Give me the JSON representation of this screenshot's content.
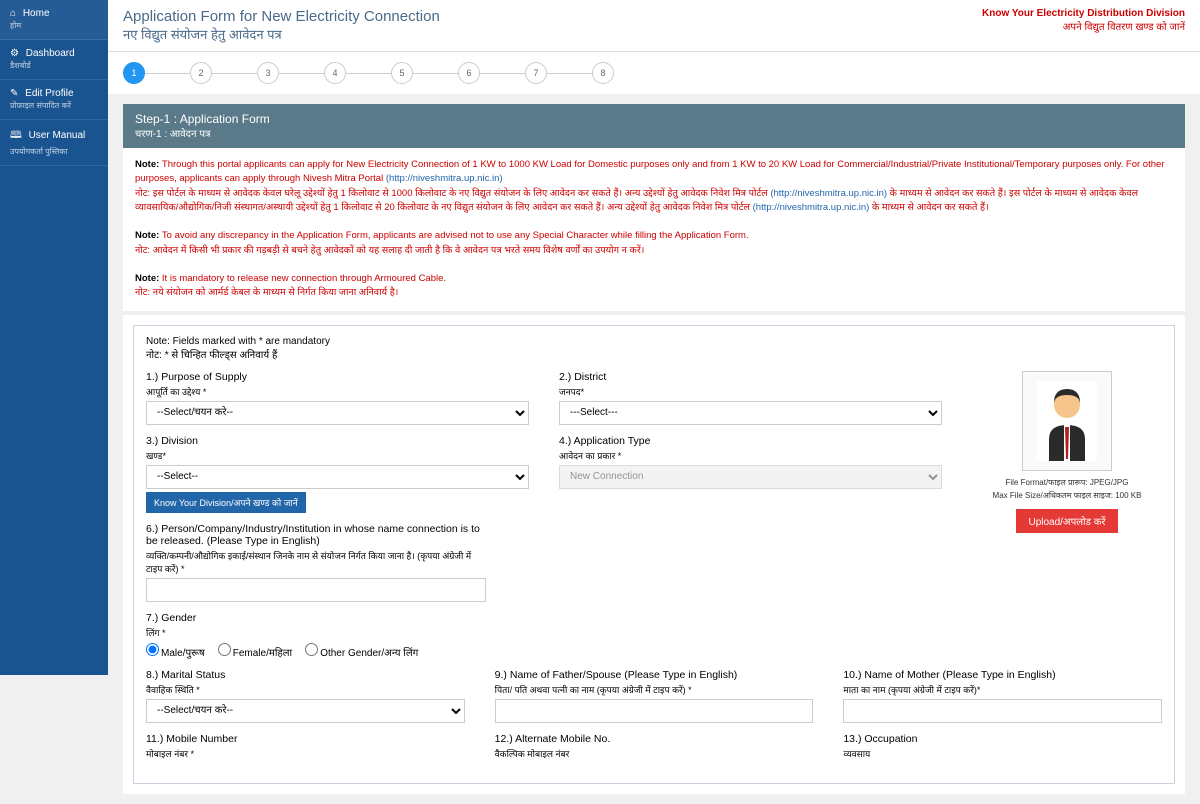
{
  "sidebar": {
    "items": [
      {
        "icon": "⌂",
        "label": "Home",
        "sub": "होम"
      },
      {
        "icon": "⚙",
        "label": "Dashboard",
        "sub": "डैशबोर्ड"
      },
      {
        "icon": "✎",
        "label": "Edit Profile",
        "sub": "प्रोफ़ाइल संपादित करें"
      },
      {
        "icon": "🕮",
        "label": "User Manual",
        "sub": "उपयोगकर्ता पुस्तिका"
      }
    ]
  },
  "header": {
    "title_en": "Application Form for New Electricity Connection",
    "title_hi": "नए विद्युत संयोजन हेतु आवेदन पत्र",
    "right1": "Know Your Electricity Distribution Division",
    "right2": "अपने विद्युत वितरण खण्ड को जानें"
  },
  "stepper": {
    "current": 1,
    "total": 8
  },
  "section": {
    "title": "Step-1 : Application Form",
    "subtitle": "चरण-1 : आवेदन पत्र"
  },
  "notes": {
    "n1_label": "Note: ",
    "n1_red": "Through this portal applicants can apply for New Electricity Connection of 1 KW to 1000 KW Load for Domestic purposes only and from 1 KW to 20 KW Load for Commercial/Industrial/Private Institutional/Temporary purposes only. For other purposes, applicants can apply through Nivesh Mitra Portal ",
    "n1_link": "(http://niveshmitra.up.nic.in)",
    "n2_red1": "नोट: इस पोर्टल के माध्यम से आवेदक केवल घरेलू उद्देश्यों हेतु 1 किलोवाट से 1000 किलोवाट के नए विद्युत संयोजन के लिए आवेदन कर सकते हैं। अन्य उद्देश्यों हेतु आवेदक निवेश मित्र पोर्टल ",
    "n2_link1": "(http://niveshmitra.up.nic.in)",
    "n2_red2": " के माध्यम से आवेदन कर सकते हैं। इस पोर्टल के माध्यम से आवेदक केवल व्यावसायिक/औद्योगिक/निजी संस्थागत/अस्थायी उद्देश्यों हेतु 1 किलोवाट से 20 किलोवाट के नए विद्युत संयोजन के लिए आवेदन कर सकते हैं। अन्य उद्देश्यों हेतु आवेदक निवेश मित्र पोर्टल ",
    "n2_link2": "(http://niveshmitra.up.nic.in)",
    "n2_red3": " के माध्यम से आवेदन कर सकते हैं।",
    "n3_label": "Note: ",
    "n3_red": "To avoid any discrepancy in the Application Form, applicants are advised not to use any Special Character while filling the Application Form.",
    "n4_red": "नोट: आवेदन में किसी भी प्रकार की गड़बड़ी से बचने हेतु आवेदकों को यह सलाह दी जाती है कि वे आवेदन पत्र भरते समय विशेष वर्णों का उपयोग न करें।",
    "n5_label": "Note: ",
    "n5_red": "It is mandatory to release new connection through Armoured Cable.",
    "n6_red": "नोट: नये संयोजन को आर्मर्ड केबल के माध्यम से निर्गत किया जाना अनिवार्य है।"
  },
  "form": {
    "mandatory_en": "Note: Fields marked with * are mandatory",
    "mandatory_hi": "नोट: * से चिन्हित फील्ड्स अनिवार्य हैं",
    "f1_num": "1.)",
    "f1_label": "Purpose of Supply",
    "f1_sub": "आपूर्ति का उद्देश्य *",
    "f1_placeholder": "--Select/चयन करे--",
    "f2_num": "2.)",
    "f2_label": "District",
    "f2_sub": "जनपद*",
    "f2_placeholder": "---Select---",
    "f3_num": "3.)",
    "f3_label": "Division",
    "f3_sub": "खण्ड*",
    "f3_placeholder": "--Select--",
    "f3_btn": "Know Your Division/अपने खण्ड को जानें",
    "f4_num": "4.)",
    "f4_label": "Application Type",
    "f4_sub": "आवेदन का प्रकार *",
    "f4_value": "New Connection",
    "f6_num": "6.)",
    "f6_label": "Person/Company/Industry/Institution in whose name connection is to be released. (Please Type in English)",
    "f6_sub": "व्यक्ति/कम्पनी/औद्योगिक इकाई/संस्थान जिनके नाम से संयोजन निर्गत किया जाना है। (कृपया अंग्रेजी में टाइप करें) *",
    "f7_num": "7.)",
    "f7_label": "Gender",
    "f7_sub": "लिंग *",
    "f7_opt1": "Male/पुरूष",
    "f7_opt2": "Female/महिला",
    "f7_opt3": "Other Gender/अन्य लिंग",
    "f8_num": "8.)",
    "f8_label": "Marital Status",
    "f8_sub": "वैवाहिक स्थिति *",
    "f8_placeholder": "--Select/चयन करे--",
    "f9_num": "9.)",
    "f9_label": "Name of Father/Spouse (Please Type in English)",
    "f9_sub": "पिता/ पति अथवा पत्नी का नाम (कृपया अंग्रेजी में टाइप करें) *",
    "f10_num": "10.)",
    "f10_label": "Name of Mother (Please Type in English)",
    "f10_sub": "माता का नाम (कृपया अंग्रेजी में टाइप करें)*",
    "f11_num": "11.)",
    "f11_label": "Mobile Number",
    "f11_sub": "मोबाइल नंबर *",
    "f12_num": "12.)",
    "f12_label": "Alternate Mobile No.",
    "f12_sub": "वैकल्पिक मोबाइल नंबर",
    "f13_num": "13.)",
    "f13_label": "Occupation",
    "f13_sub": "व्यवसाय",
    "photo_cap1": "File Format/फाइल प्रारूप: JPEG/JPG",
    "photo_cap2": "Max File Size/अधिकतम फाइल साइज: 100 KB",
    "upload_btn": "Upload/अपलोड करें"
  }
}
